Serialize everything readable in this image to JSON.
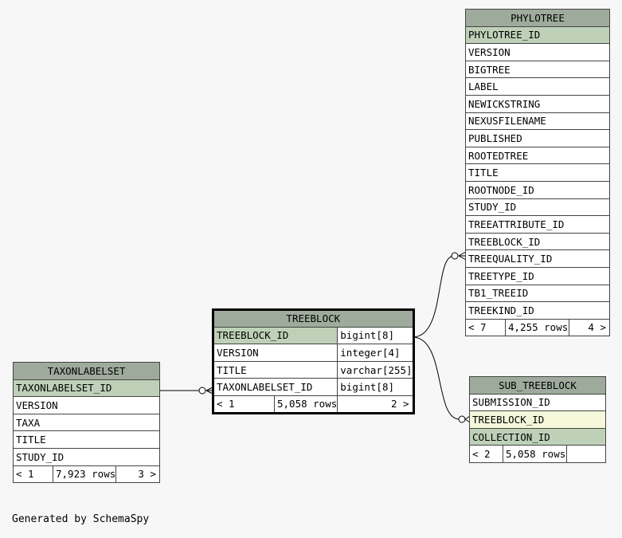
{
  "tables": {
    "phylotree": {
      "name": "PHYLOTREE",
      "columns": [
        "PHYLOTREE_ID",
        "VERSION",
        "BIGTREE",
        "LABEL",
        "NEWICKSTRING",
        "NEXUSFILENAME",
        "PUBLISHED",
        "ROOTEDTREE",
        "TITLE",
        "ROOTNODE_ID",
        "STUDY_ID",
        "TREEATTRIBUTE_ID",
        "TREEBLOCK_ID",
        "TREEQUALITY_ID",
        "TREETYPE_ID",
        "TB1_TREEID",
        "TREEKIND_ID"
      ],
      "footer": {
        "parents": "< 7",
        "rows": "4,255 rows",
        "children": "4 >"
      }
    },
    "treeblock": {
      "name": "TREEBLOCK",
      "columns": [
        {
          "name": "TREEBLOCK_ID",
          "type": "bigint[8]"
        },
        {
          "name": "VERSION",
          "type": "integer[4]"
        },
        {
          "name": "TITLE",
          "type": "varchar[255]"
        },
        {
          "name": "TAXONLABELSET_ID",
          "type": "bigint[8]"
        }
      ],
      "footer": {
        "parents": "< 1",
        "rows": "5,058 rows",
        "children": "2 >"
      }
    },
    "taxonlabelset": {
      "name": "TAXONLABELSET",
      "columns": [
        "TAXONLABELSET_ID",
        "VERSION",
        "TAXA",
        "TITLE",
        "STUDY_ID"
      ],
      "footer": {
        "parents": "< 1",
        "rows": "7,923 rows",
        "children": "3 >"
      }
    },
    "sub_treeblock": {
      "name": "SUB_TREEBLOCK",
      "columns": [
        "SUBMISSION_ID",
        "TREEBLOCK_ID",
        "COLLECTION_ID"
      ],
      "footer": {
        "parents": "< 2",
        "rows": "5,058 rows",
        "children": ""
      }
    }
  },
  "footer_text": "Generated by SchemaSpy"
}
